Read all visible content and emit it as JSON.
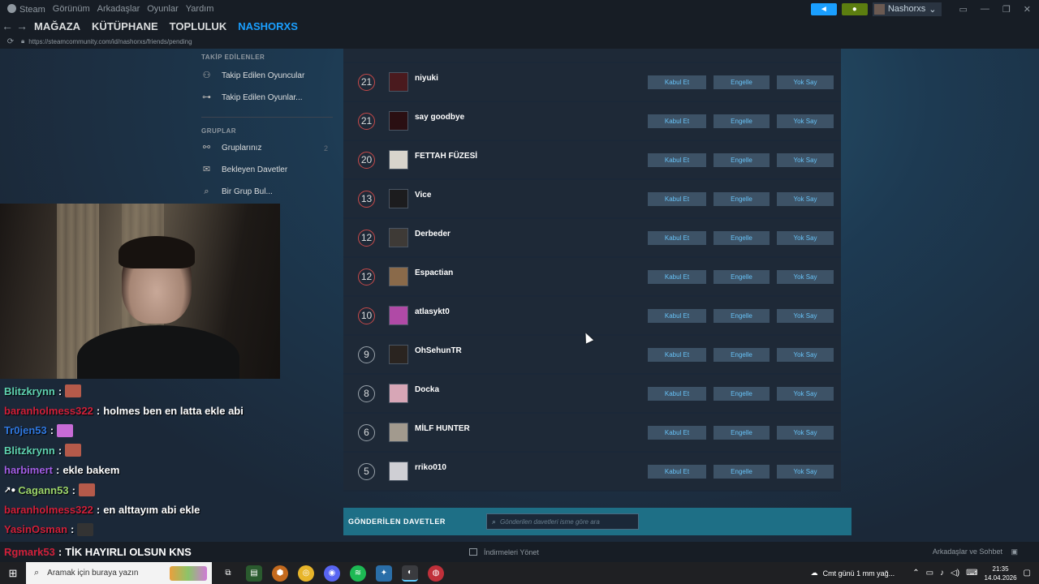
{
  "window": {
    "menu": [
      "Steam",
      "Görünüm",
      "Arkadaşlar",
      "Oyunlar",
      "Yardım"
    ],
    "username": "Nashorxs"
  },
  "nav": {
    "tabs": [
      "MAĞAZA",
      "KÜTÜPHANE",
      "TOPLULUK",
      "NASHORXS"
    ],
    "active_tab": "NASHORXS",
    "url": "https://steamcommunity.com/id/nashorxs/friends/pending"
  },
  "sidebar": {
    "followed_header": "TAKİP EDİLENLER",
    "followed_items": [
      "Takip Edilen Oyuncular",
      "Takip Edilen Oyunlar..."
    ],
    "groups_header": "GRUPLAR",
    "groups_items": [
      {
        "label": "Gruplarınız",
        "count": "2"
      },
      {
        "label": "Bekleyen Davetler",
        "count": ""
      },
      {
        "label": "Bir Grup Bul...",
        "count": ""
      }
    ]
  },
  "requests": {
    "buttons": {
      "accept": "Kabul Et",
      "block": "Engelle",
      "ignore": "Yok Say"
    },
    "rows": [
      {
        "level": "21",
        "name": "niyuki",
        "avatar_color": "#4a1a1e",
        "level_color": "red"
      },
      {
        "level": "21",
        "name": "say goodbye",
        "avatar_color": "#2a0f12",
        "level_color": "red"
      },
      {
        "level": "20",
        "name": "FETTAH FÜZESİ",
        "avatar_color": "#d8d4cc",
        "level_color": "red"
      },
      {
        "level": "13",
        "name": "Vice",
        "avatar_color": "#1c1c1e",
        "level_color": "red"
      },
      {
        "level": "12",
        "name": "Derbeder",
        "avatar_color": "#3e3a36",
        "level_color": "red"
      },
      {
        "level": "12",
        "name": "Espactian",
        "avatar_color": "#8a6a4a",
        "level_color": "red"
      },
      {
        "level": "10",
        "name": "atlasykt0",
        "avatar_color": "#b04aa6",
        "level_color": "red"
      },
      {
        "level": "9",
        "name": "OhSehunTR",
        "avatar_color": "#2a2420",
        "level_color": "grey"
      },
      {
        "level": "8",
        "name": "Docka",
        "avatar_color": "#d7a6b6",
        "level_color": "grey"
      },
      {
        "level": "6",
        "name": "MİLF HUNTER",
        "avatar_color": "#a29a8e",
        "level_color": "grey"
      },
      {
        "level": "5",
        "name": "rriko010",
        "avatar_color": "#cfcfd4",
        "level_color": "grey"
      }
    ]
  },
  "sent_invites": {
    "title": "GÖNDERİLEN DAVETLER",
    "search_placeholder": "Gönderilen davetleri isme göre ara"
  },
  "chat": [
    {
      "user": "Blitzkrynn",
      "color": "#5fd3b0",
      "msg": "",
      "emote": "#b55a4a"
    },
    {
      "user": "baranholmess322",
      "color": "#d0203a",
      "msg": "holmes ben en latta ekle abi",
      "emote": ""
    },
    {
      "user": "Tr0jen53",
      "color": "#2f78e0",
      "msg": "",
      "emote": "#c76bd6"
    },
    {
      "user": "Blitzkrynn",
      "color": "#5fd3b0",
      "msg": "",
      "emote": "#b55a4a"
    },
    {
      "user": "harbimert",
      "color": "#a35ee6",
      "msg": "ekle bakem",
      "emote": ""
    },
    {
      "user": "Cagann53",
      "color": "#9cd46a",
      "msg": "",
      "emote": "#b55a4a"
    },
    {
      "user": "baranholmess322",
      "color": "#d0203a",
      "msg": "en alttayım abi ekle",
      "emote": ""
    },
    {
      "user": "YasinOsman",
      "color": "#d0203a",
      "msg": "",
      "emote": "#333333"
    }
  ],
  "chat_last": {
    "user": "Rgmark53",
    "color": "#d0203a",
    "msg": "TİK HAYIRLI OLSUN KNS"
  },
  "steam_bottom": {
    "downloads": "İndirmeleri Yönet",
    "friends": "Arkadaşlar ve Sohbet"
  },
  "taskbar": {
    "search_placeholder": "Aramak için buraya yazın",
    "weather": "Cmt günü 1 mm yağ...",
    "time": "21:35",
    "date": "14.04.2026"
  },
  "colors": {
    "accent": "#1a9fff",
    "button_text": "#67c1f5",
    "sent_bar": "#1e6f86"
  }
}
